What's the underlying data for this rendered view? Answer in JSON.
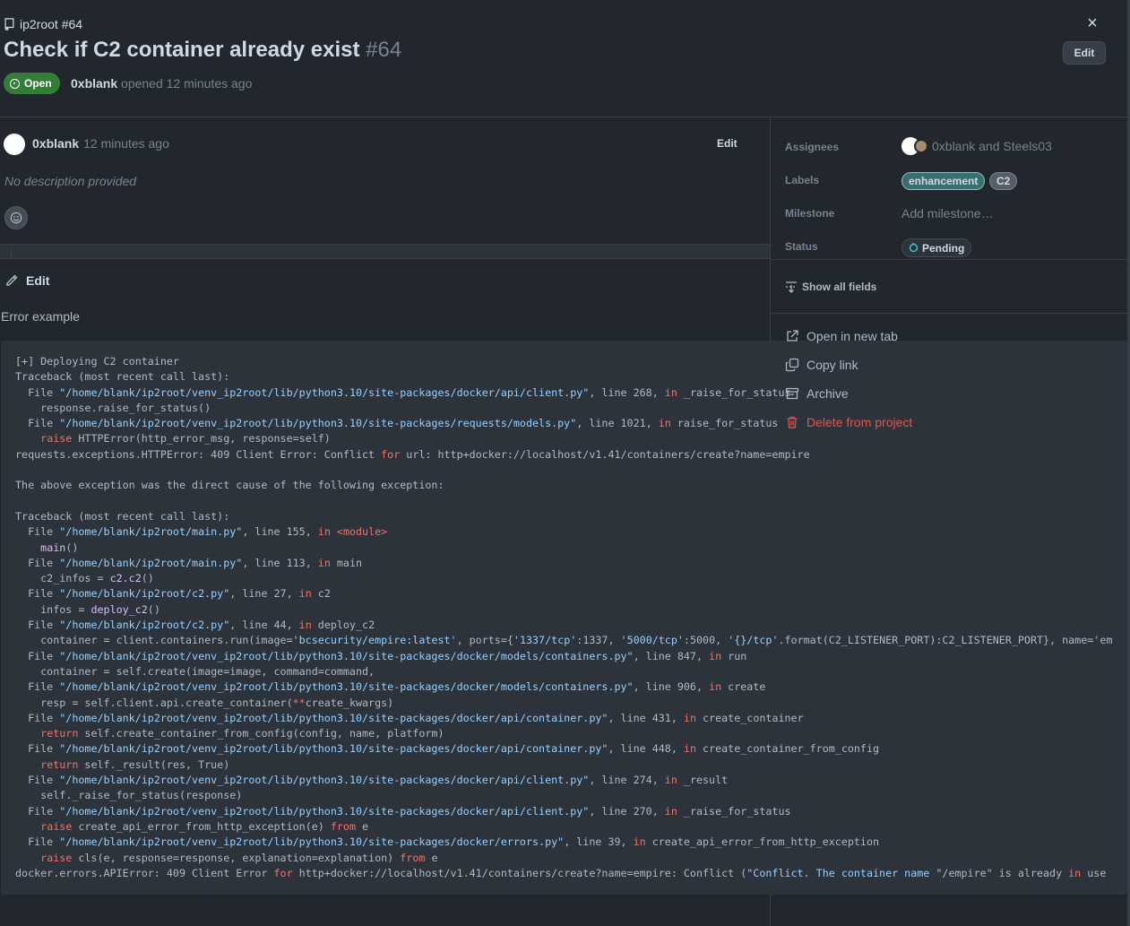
{
  "header": {
    "breadcrumb": "ip2root #64",
    "title": "Check if C2 container already exist",
    "number": "#64",
    "edit_label": "Edit",
    "close_glyph": "×",
    "status_badge": "Open",
    "author": "0xblank",
    "opened_text": "opened 12 minutes ago"
  },
  "comment": {
    "author": "0xblank",
    "time": "12 minutes ago",
    "edit_label": "Edit",
    "body": "No description provided"
  },
  "edit_section": {
    "label": "Edit",
    "heading": "Error example"
  },
  "code_lines": [
    "[+] Deploying C2 container",
    "Traceback (most recent call last):",
    "  File \"/home/blank/ip2root/venv_ip2root/lib/python3.10/site-packages/docker/api/client.py\", line 268, in _raise_for_status",
    "    response.raise_for_status()",
    "  File \"/home/blank/ip2root/venv_ip2root/lib/python3.10/site-packages/requests/models.py\", line 1021, in raise_for_status",
    "    raise HTTPError(http_error_msg, response=self)",
    "requests.exceptions.HTTPError: 409 Client Error: Conflict for url: http+docker://localhost/v1.41/containers/create?name=empire",
    "",
    "The above exception was the direct cause of the following exception:",
    "",
    "Traceback (most recent call last):",
    "  File \"/home/blank/ip2root/main.py\", line 155, in <module>",
    "    main()",
    "  File \"/home/blank/ip2root/main.py\", line 113, in main",
    "    c2_infos = c2.c2()",
    "  File \"/home/blank/ip2root/c2.py\", line 27, in c2",
    "    infos = deploy_c2()",
    "  File \"/home/blank/ip2root/c2.py\", line 44, in deploy_c2",
    "    container = client.containers.run(image='bcsecurity/empire:latest', ports={'1337/tcp':1337, '5000/tcp':5000, '{}/tcp'.format(C2_LISTENER_PORT):C2_LISTENER_PORT}, name='em",
    "  File \"/home/blank/ip2root/venv_ip2root/lib/python3.10/site-packages/docker/models/containers.py\", line 847, in run",
    "    container = self.create(image=image, command=command,",
    "  File \"/home/blank/ip2root/venv_ip2root/lib/python3.10/site-packages/docker/models/containers.py\", line 906, in create",
    "    resp = self.client.api.create_container(**create_kwargs)",
    "  File \"/home/blank/ip2root/venv_ip2root/lib/python3.10/site-packages/docker/api/container.py\", line 431, in create_container",
    "    return self.create_container_from_config(config, name, platform)",
    "  File \"/home/blank/ip2root/venv_ip2root/lib/python3.10/site-packages/docker/api/container.py\", line 448, in create_container_from_config",
    "    return self._result(res, True)",
    "  File \"/home/blank/ip2root/venv_ip2root/lib/python3.10/site-packages/docker/api/client.py\", line 274, in _result",
    "    self._raise_for_status(response)",
    "  File \"/home/blank/ip2root/venv_ip2root/lib/python3.10/site-packages/docker/api/client.py\", line 270, in _raise_for_status",
    "    raise create_api_error_from_http_exception(e) from e",
    "  File \"/home/blank/ip2root/venv_ip2root/lib/python3.10/site-packages/docker/errors.py\", line 39, in create_api_error_from_http_exception",
    "    raise cls(e, response=response, explanation=explanation) from e",
    "docker.errors.APIError: 409 Client Error for http+docker://localhost/v1.41/containers/create?name=empire: Conflict (\"Conflict. The container name \"/empire\" is already in use"
  ],
  "sidebar": {
    "assignees_label": "Assignees",
    "assignees_value": "0xblank and Steels03",
    "labels_label": "Labels",
    "labels": [
      "enhancement",
      "C2"
    ],
    "milestone_label": "Milestone",
    "milestone_placeholder": "Add milestone…",
    "status_label": "Status",
    "status_value": "Pending",
    "show_all_fields": "Show all fields"
  },
  "menu": {
    "open_new_tab": "Open in new tab",
    "copy_link": "Copy link",
    "archive": "Archive",
    "delete": "Delete from project"
  },
  "colors": {
    "background": "#22272e",
    "open_badge": "#347d39",
    "danger": "#e5534b",
    "string": "#96d0ff",
    "keyword": "#f47067"
  }
}
